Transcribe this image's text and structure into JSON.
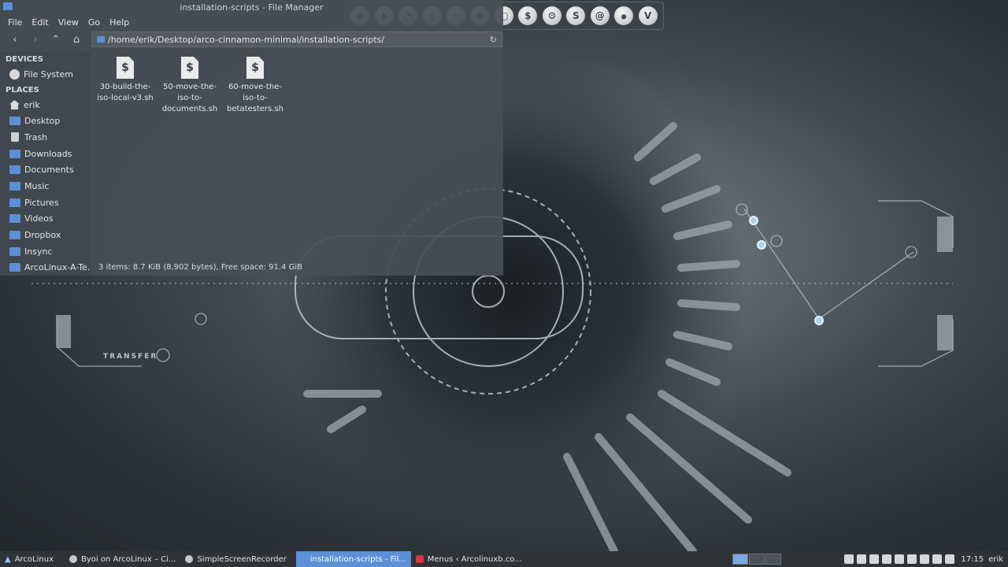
{
  "window": {
    "title": "installation-scripts - File Manager"
  },
  "menu": [
    "File",
    "Edit",
    "View",
    "Go",
    "Help"
  ],
  "toolbar": {
    "back": "‹",
    "forward": "›",
    "up": "⌃",
    "home": "⌂",
    "path": "/home/erik/Desktop/arco-cinnamon-minimal/installation-scripts/",
    "reload": "↻"
  },
  "sidebar": {
    "devices_header": "DEVICES",
    "devices": [
      {
        "label": "File System",
        "icon": "drive-icon"
      }
    ],
    "places_header": "PLACES",
    "places": [
      {
        "label": "erik",
        "icon": "home-icon"
      },
      {
        "label": "Desktop",
        "icon": "folder-icon"
      },
      {
        "label": "Trash",
        "icon": "trash-icon"
      },
      {
        "label": "Downloads",
        "icon": "folder-icon"
      },
      {
        "label": "Documents",
        "icon": "folder-icon"
      },
      {
        "label": "Music",
        "icon": "folder-icon"
      },
      {
        "label": "Pictures",
        "icon": "folder-icon"
      },
      {
        "label": "Videos",
        "icon": "folder-icon"
      },
      {
        "label": "Dropbox",
        "icon": "folder-icon"
      },
      {
        "label": "Insync",
        "icon": "folder-icon"
      },
      {
        "label": "ArcoLinux-A-Te...",
        "icon": "folder-icon"
      }
    ]
  },
  "files": [
    {
      "icon_glyph": "$",
      "lines": [
        "30-build-the-",
        "iso-local-v3.sh"
      ]
    },
    {
      "icon_glyph": "$",
      "lines": [
        "50-move-the-",
        "iso-to-",
        "documents.sh"
      ]
    },
    {
      "icon_glyph": "$",
      "lines": [
        "60-move-the-",
        "iso-to-",
        "betatesters.sh"
      ]
    }
  ],
  "status": "3 items: 8.7 KiB (8,902 bytes), Free space: 91.4 GiB",
  "wallpaper": {
    "text": "TRANSFER"
  },
  "dock": [
    "S",
    "S",
    "V"
  ],
  "taskbar": {
    "items": [
      {
        "label": "ArcoLinux",
        "icon": "arco-logo-icon"
      },
      {
        "label": "Byoi on ArcoLinux – Ci...",
        "icon": "media-icon"
      },
      {
        "label": "SimpleScreenRecorder",
        "icon": "recorder-icon"
      },
      {
        "label": "installation-scripts - Fil...",
        "icon": "folder-icon",
        "active": true
      },
      {
        "label": "Menus ‹ Arcolinuxb.co...",
        "icon": "vivaldi-icon"
      }
    ],
    "clock": "17:15",
    "user": "erik"
  },
  "colors": {
    "accent": "#5b8fd6",
    "taskbar": "#2e3338"
  }
}
